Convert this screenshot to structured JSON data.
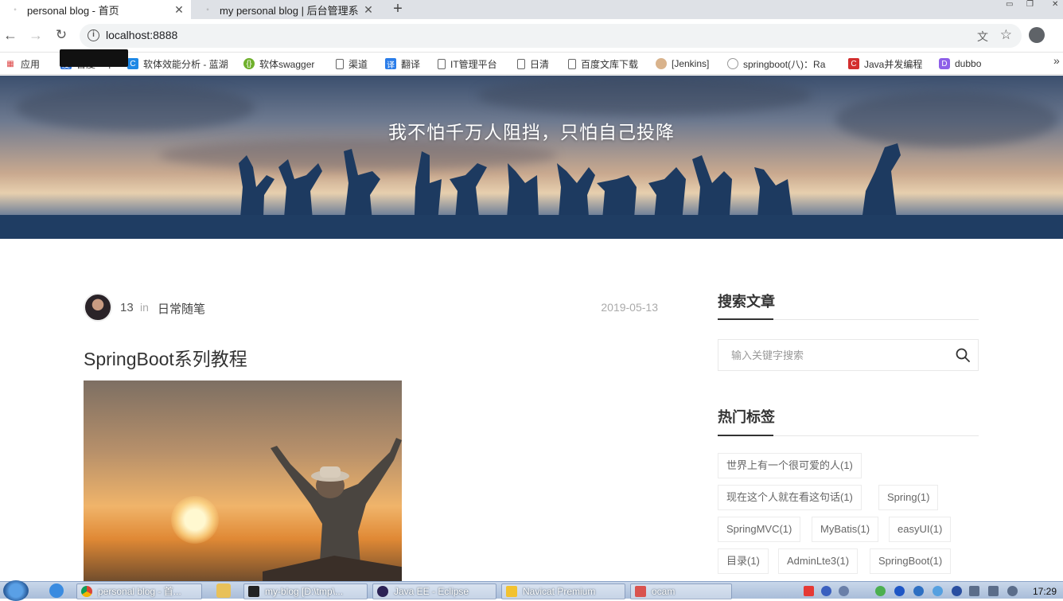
{
  "browser": {
    "tabs": [
      {
        "title": "personal blog - 首页",
        "active": true
      },
      {
        "title": "my personal blog | 后台管理系",
        "active": false
      }
    ],
    "new_tab": "+",
    "url": "localhost:8888",
    "bookmarks": [
      "应用",
      "百度一下",
      "软体效能分析 - 蓝湖",
      "软体swagger",
      "渠道",
      "翻译",
      "IT管理平台",
      "日清",
      "百度文库下载",
      "[Jenkins]",
      "springboot(八)：Ra",
      "Java并发编程",
      "dubbo"
    ],
    "bookmarks_more": "»"
  },
  "hero": {
    "motto": "我不怕千万人阻挡，只怕自己投降"
  },
  "post": {
    "author": "13",
    "in_word": "in",
    "category": "日常随笔",
    "date": "2019-05-13",
    "title": "SpringBoot系列教程"
  },
  "sidebar": {
    "search_heading": "搜索文章",
    "search_placeholder": "输入关键字搜索",
    "tags_heading": "热门标签",
    "tags": [
      "世界上有一个很可爱的人(1)",
      "现在这个人就在看这句话(1)",
      "Spring(1)",
      "SpringMVC(1)",
      "MyBatis(1)",
      "easyUI(1)",
      "目录(1)",
      "AdminLte3(1)",
      "SpringBoot(1)"
    ]
  },
  "taskbar": {
    "tasks": [
      "personal blog - 首...",
      "my-blog [D:\\tmp\\...",
      "Java EE - Eclipse",
      "Navicat Premium",
      "ocam"
    ],
    "clock": "17:29"
  }
}
